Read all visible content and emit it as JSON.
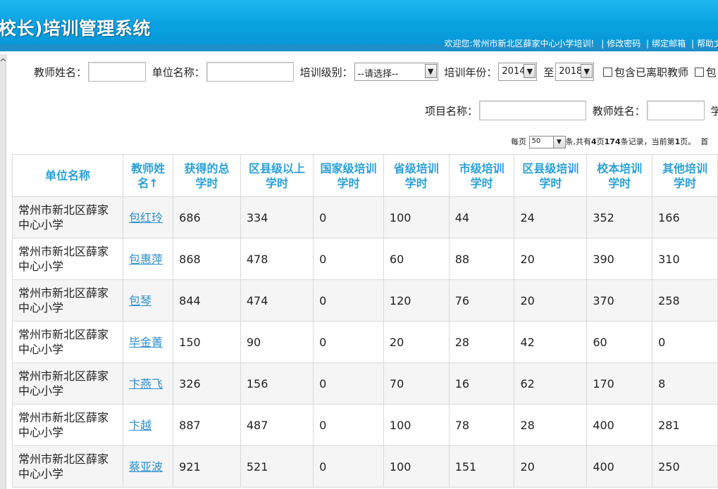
{
  "header": {
    "title": "校长)培训管理系统",
    "welcome": "欢迎您:常州市新北区薛家中心小学培训!",
    "links": [
      "修改密码",
      "绑定邮箱",
      "帮助文"
    ]
  },
  "search": {
    "teacher_name_label": "教师姓名：",
    "unit_name_label": "单位名称：",
    "level_label": "培训级别：",
    "level_value": "--请选择--",
    "year_label": "培训年份：",
    "year_from": "2014",
    "year_to_label": "至",
    "year_to": "2018",
    "include_left_label": "包含已离职教师",
    "include_more_label": "包",
    "project_label": "项目名称：",
    "teacher_name2_label": "教师姓名：",
    "trailing_label": "学"
  },
  "pager": {
    "per_page_label": "每页",
    "per_page": "50",
    "total_prefix": "条,共有",
    "pages": "4",
    "pages_suffix": "页",
    "records": "174",
    "records_suffix": "条记录，当前第",
    "current": "1",
    "current_suffix": "页。",
    "first": "首"
  },
  "table": {
    "headers": [
      "单位名称",
      "教师姓名↑",
      "获得的总学时",
      "区县级以上学时",
      "国家级培训学时",
      "省级培训学时",
      "市级培训学时",
      "区县级培训学时",
      "校本培训学时",
      "其他培训学时"
    ],
    "rows": [
      [
        "常州市新北区薛家中心小学",
        "包红玲",
        "686",
        "334",
        "0",
        "100",
        "44",
        "24",
        "352",
        "166"
      ],
      [
        "常州市新北区薛家中心小学",
        "包惠萍",
        "868",
        "478",
        "0",
        "60",
        "88",
        "20",
        "390",
        "310"
      ],
      [
        "常州市新北区薛家中心小学",
        "包琴",
        "844",
        "474",
        "0",
        "120",
        "76",
        "20",
        "370",
        "258"
      ],
      [
        "常州市新北区薛家中心小学",
        "毕金菁",
        "150",
        "90",
        "0",
        "20",
        "28",
        "42",
        "60",
        "0"
      ],
      [
        "常州市新北区薛家中心小学",
        "卞燕飞",
        "326",
        "156",
        "0",
        "70",
        "16",
        "62",
        "170",
        "8"
      ],
      [
        "常州市新北区薛家中心小学",
        "卞越",
        "887",
        "487",
        "0",
        "100",
        "78",
        "28",
        "400",
        "281"
      ],
      [
        "常州市新北区薛家中心小学",
        "蔡亚波",
        "921",
        "521",
        "0",
        "100",
        "151",
        "20",
        "400",
        "250"
      ]
    ]
  },
  "colors": {
    "header_blue": "#0aa3e2",
    "link_blue": "#2a8fd0",
    "th_text": "#2aa0d8"
  }
}
